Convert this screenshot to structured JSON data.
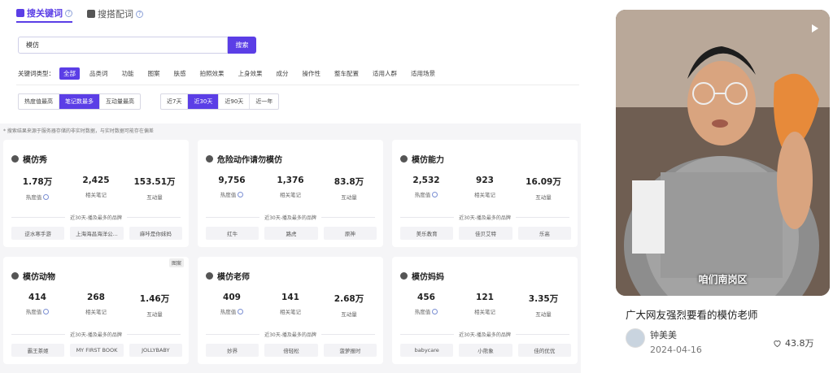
{
  "tabs": [
    {
      "label": "搜关键词",
      "active": true
    },
    {
      "label": "搜搭配词",
      "active": false
    }
  ],
  "search": {
    "value": "模仿",
    "button": "搜索"
  },
  "keyword_type": {
    "label": "关键词类型：",
    "options": [
      "全部",
      "品类词",
      "功能",
      "图案",
      "肤感",
      "拍照效果",
      "上身效果",
      "成分",
      "操作性",
      "整车配置",
      "适用人群",
      "适用场景"
    ],
    "selected": "全部"
  },
  "sort_options": [
    "热度值最高",
    "笔记数最多",
    "互动量最高"
  ],
  "sort_selected": "笔记数最多",
  "range_options": [
    "近7天",
    "近30天",
    "近90天",
    "近一年"
  ],
  "range_selected": "近30天",
  "notice": "* 搜索结果来源于服务器存储的非实时数据，与实时数据可能存在偏差",
  "stat_labels": {
    "heat": "热度值",
    "notes": "相关笔记",
    "interact": "互动量"
  },
  "brand_caption": "近30天-播及最多的品牌",
  "cards": [
    {
      "title": "模仿秀",
      "heat": "1.78万",
      "notes": "2,425",
      "interact": "153.51万",
      "brands": [
        "逆水寒手游",
        "上海海昌海洋公...",
        "麻咔是你妹妈"
      ]
    },
    {
      "title": "危险动作请勿模仿",
      "heat": "9,756",
      "notes": "1,376",
      "interact": "83.8万",
      "brands": [
        "红牛",
        "路虎",
        "原神"
      ]
    },
    {
      "title": "模仿能力",
      "heat": "2,532",
      "notes": "923",
      "interact": "16.09万",
      "brands": [
        "美乐教育",
        "佳贝艾特",
        "乐高"
      ]
    },
    {
      "title": "模仿动物",
      "heat": "414",
      "notes": "268",
      "interact": "1.46万",
      "brands": [
        "霸王茶姬",
        "MY FIRST BOOK",
        "JOLLYBABY"
      ],
      "corner_tag": "图案"
    },
    {
      "title": "模仿老师",
      "heat": "409",
      "notes": "141",
      "interact": "2.68万",
      "brands": [
        "妙界",
        "倍轻松",
        "菠萝报时"
      ]
    },
    {
      "title": "模仿妈妈",
      "heat": "456",
      "notes": "121",
      "interact": "3.35万",
      "brands": [
        "babycare",
        "小熊象",
        "佳的优优"
      ]
    }
  ],
  "video": {
    "caption": "咱们南岗区",
    "title": "广大网友强烈要看的模仿老师",
    "author": "钟美美",
    "date": "2024-04-16",
    "likes": "43.8万"
  },
  "colors": {
    "accent": "#5b3ee6"
  }
}
